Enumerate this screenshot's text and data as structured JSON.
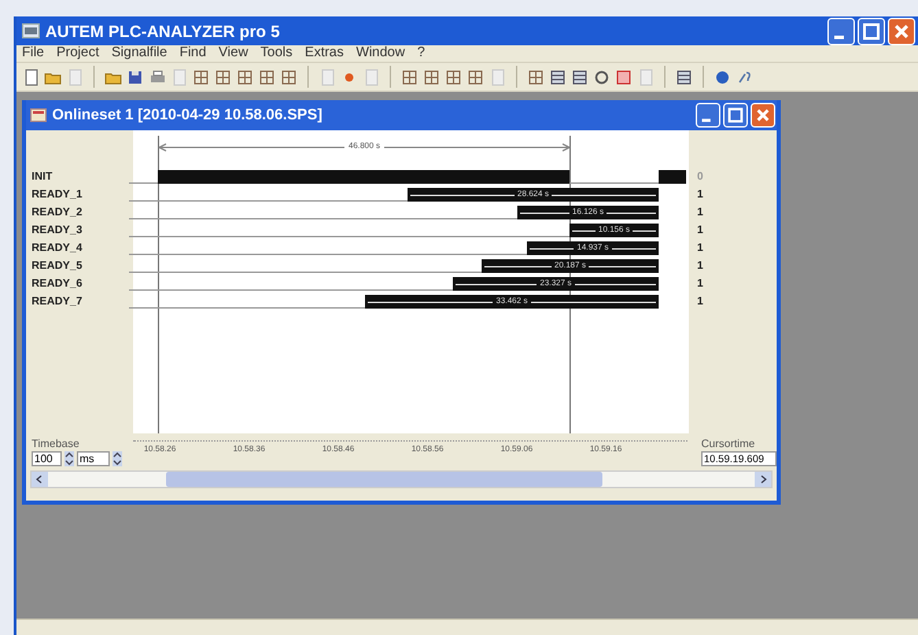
{
  "window": {
    "title": "AUTEM PLC-ANALYZER pro 5"
  },
  "menu": [
    "File",
    "Project",
    "Signalfile",
    "Find",
    "View",
    "Tools",
    "Extras",
    "Window",
    "?"
  ],
  "child_window": {
    "title": "Onlineset 1 [2010-04-29 10.58.06.SPS]",
    "measurement": "46.800 s",
    "signals": [
      {
        "name": "INIT",
        "kind": "pulse",
        "value": "0",
        "high": false
      },
      {
        "name": "READY_1",
        "kind": "duration",
        "duration": "28.624 s",
        "value": "1",
        "high": true
      },
      {
        "name": "READY_2",
        "kind": "duration",
        "duration": "16.126 s",
        "value": "1",
        "high": true
      },
      {
        "name": "READY_3",
        "kind": "duration",
        "duration": "10.156 s",
        "value": "1",
        "high": true
      },
      {
        "name": "READY_4",
        "kind": "duration",
        "duration": "14.937 s",
        "value": "1",
        "high": true
      },
      {
        "name": "READY_5",
        "kind": "duration",
        "duration": "20.187 s",
        "value": "1",
        "high": true
      },
      {
        "name": "READY_6",
        "kind": "duration",
        "duration": "23.327 s",
        "value": "1",
        "high": true
      },
      {
        "name": "READY_7",
        "kind": "duration",
        "duration": "33.462 s",
        "value": "1",
        "high": true
      }
    ],
    "axis_ticks": [
      "10.58.26",
      "10.58.36",
      "10.58.46",
      "10.58.56",
      "10.59.06",
      "10.59.16"
    ],
    "timebase": {
      "label": "Timebase",
      "value": "100",
      "unit": "ms"
    },
    "cursortime": {
      "label": "Cursortime",
      "value": "10.59.19.609"
    }
  }
}
